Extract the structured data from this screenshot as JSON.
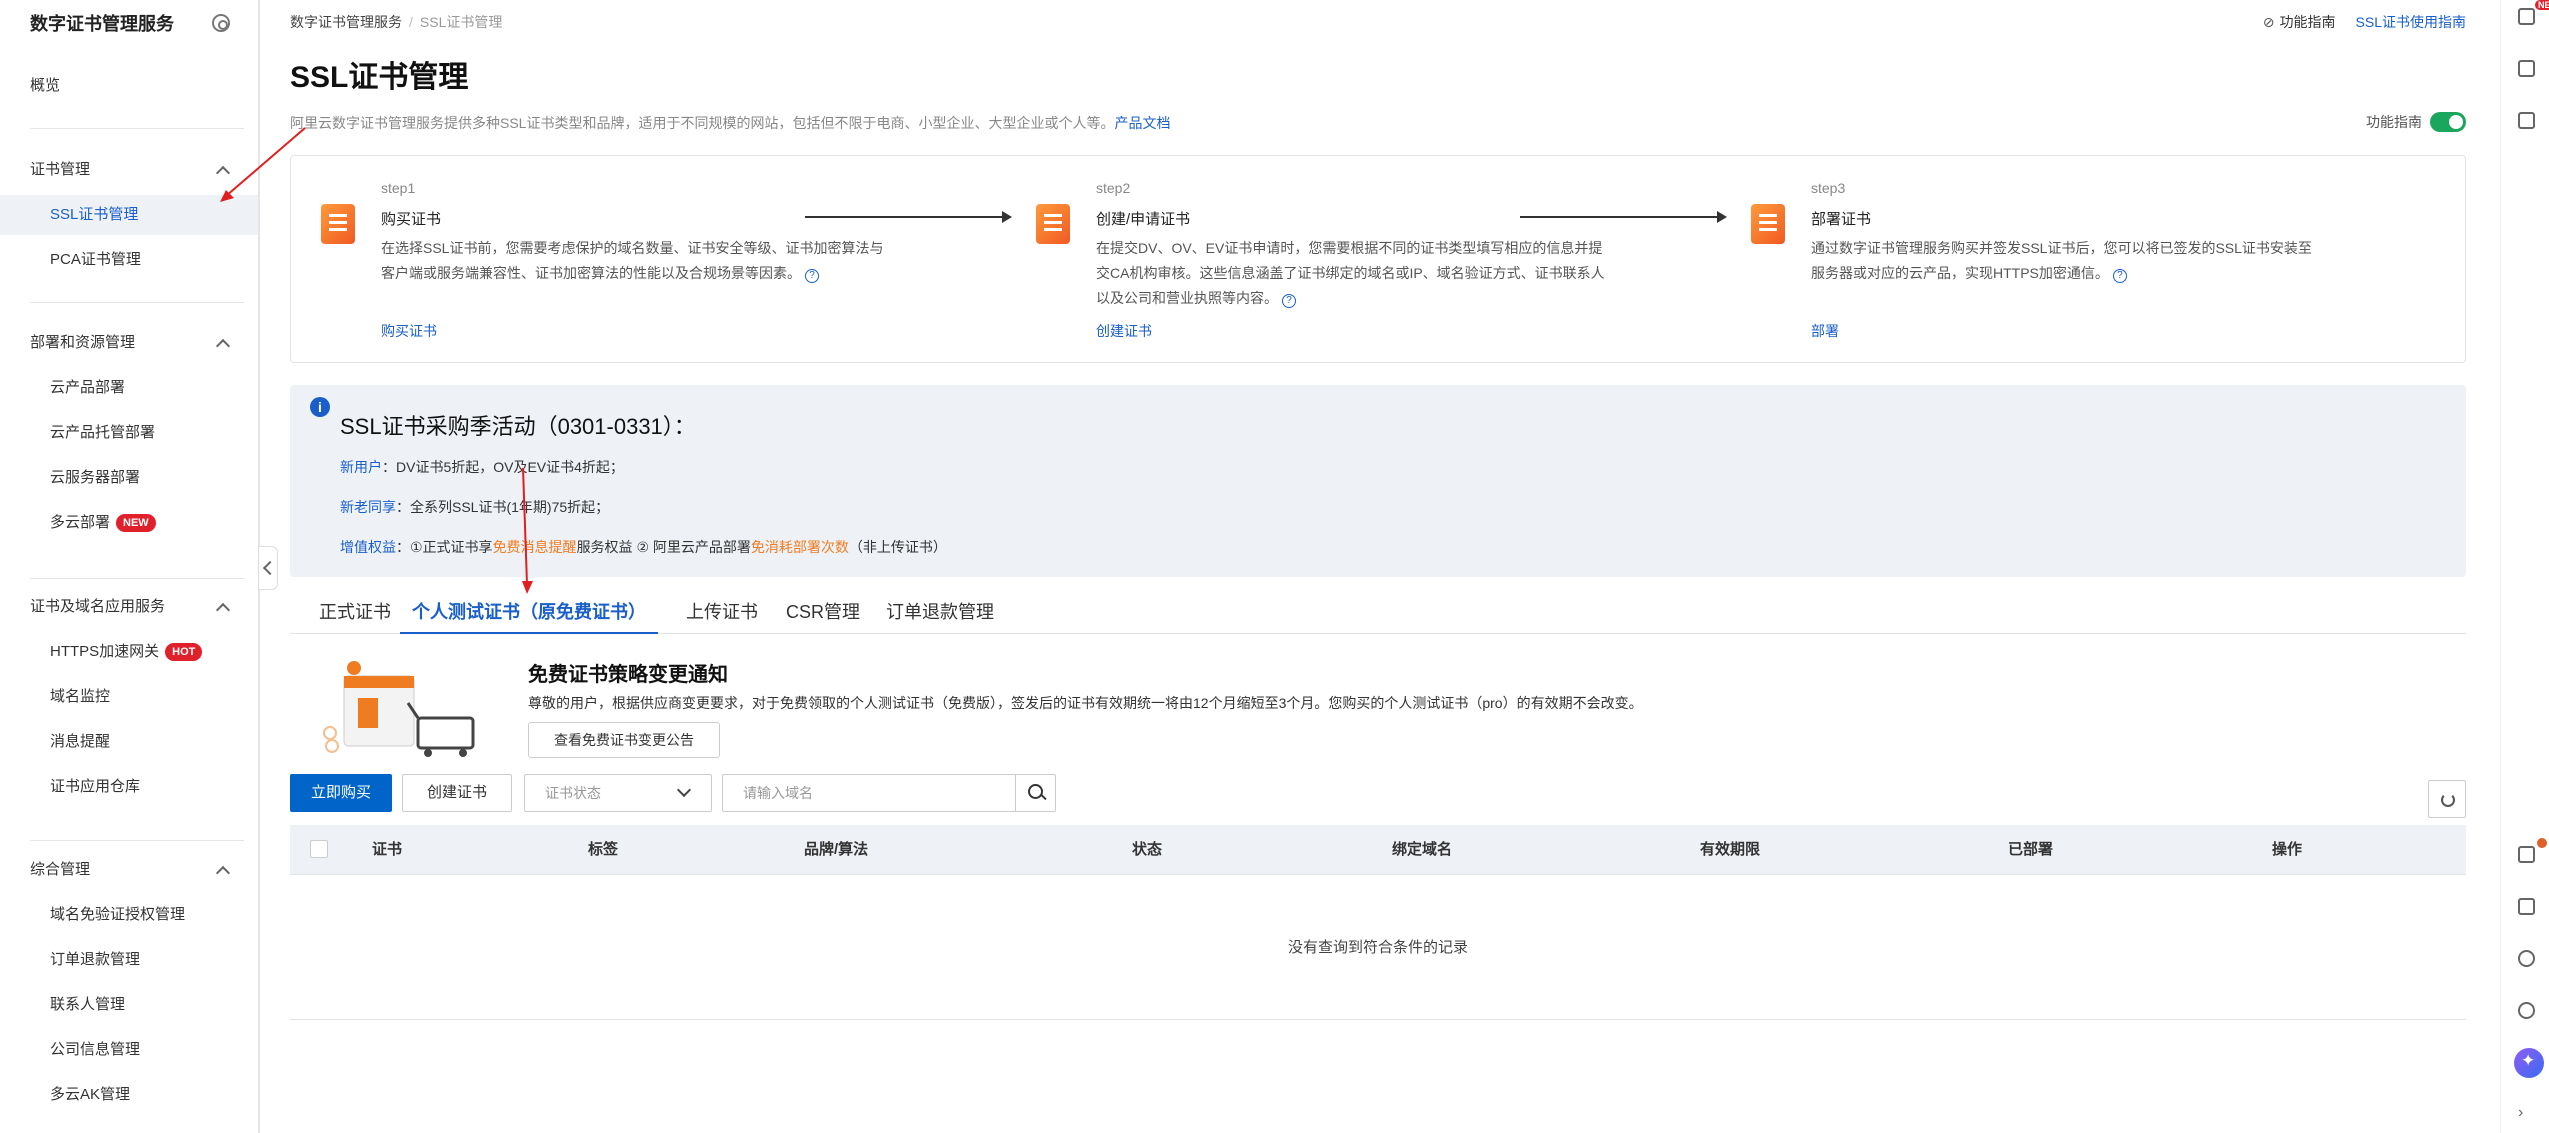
{
  "sidebar": {
    "title": "数字证书管理服务",
    "overview": "概览",
    "groups": [
      {
        "label": "证书管理",
        "items": [
          "SSL证书管理",
          "PCA证书管理"
        ]
      },
      {
        "label": "部署和资源管理",
        "items": [
          "云产品部署",
          "云产品托管部署",
          "云服务器部署",
          "多云部署"
        ]
      },
      {
        "label": "证书及域名应用服务",
        "items": [
          "HTTPS加速网关",
          "域名监控",
          "消息提醒",
          "证书应用仓库"
        ]
      },
      {
        "label": "综合管理",
        "items": [
          "域名免验证授权管理",
          "订单退款管理",
          "联系人管理",
          "公司信息管理",
          "多云AK管理"
        ]
      }
    ],
    "tags": {
      "new": "NEW",
      "hot": "HOT"
    }
  },
  "rail": {
    "badge": "NEW"
  },
  "breadcrumb": {
    "root": "数字证书管理服务",
    "current": "SSL证书管理"
  },
  "top_links": {
    "guide": "功能指南",
    "usage": "SSL证书使用指南"
  },
  "page": {
    "title": "SSL证书管理",
    "intro": "阿里云数字证书管理服务提供多种SSL证书类型和品牌，适用于不同规模的网站，包括但不限于电商、小型企业、大型企业或个人等。",
    "intro_link": "产品文档",
    "guide_toggle": "功能指南"
  },
  "steps": [
    {
      "num": "step1",
      "name": "购买证书",
      "desc": "在选择SSL证书前，您需要考虑保护的域名数量、证书安全等级、证书加密算法与客户端或服务端兼容性、证书加密算法的性能以及合规场景等因素。",
      "link": "购买证书"
    },
    {
      "num": "step2",
      "name": "创建/申请证书",
      "desc": "在提交DV、OV、EV证书申请时，您需要根据不同的证书类型填写相应的信息并提交CA机构审核。这些信息涵盖了证书绑定的域名或IP、域名验证方式、证书联系人以及公司和营业执照等内容。",
      "link": "创建证书"
    },
    {
      "num": "step3",
      "name": "部署证书",
      "desc": "通过数字证书管理服务购买并签发SSL证书后，您可以将已签发的SSL证书安装至服务器或对应的云产品，实现HTTPS加密通信。",
      "link": "部署"
    }
  ],
  "promo": {
    "title": "SSL证书采购季活动（0301-0331）：",
    "line1_k": "新用户",
    "line1": "：DV证书5折起，OV及EV证书4折起；",
    "line2_k": "新老同享",
    "line2": "：全系列SSL证书(1年期)75折起；",
    "line3_k": "增值权益",
    "line3_a": "：①正式证书享",
    "line3_hl1": "免费消息提醒",
    "line3_b": "服务权益  ② 阿里云产品部署",
    "line3_hl2": "免消耗部署次数",
    "line3_c": "（非上传证书）"
  },
  "tabs": [
    "正式证书",
    "个人测试证书（原免费证书）",
    "上传证书",
    "CSR管理",
    "订单退款管理"
  ],
  "notice": {
    "title": "免费证书策略变更通知",
    "desc": "尊敬的用户，根据供应商变更要求，对于免费领取的个人测试证书（免费版），签发后的证书有效期统一将由12个月缩短至3个月。您购买的个人测试证书（pro）的有效期不会改变。",
    "button": "查看免费证书变更公告"
  },
  "toolbar": {
    "buy": "立即购买",
    "create": "创建证书",
    "status_placeholder": "证书状态",
    "search_placeholder": "请输入域名"
  },
  "table": {
    "columns": [
      "证书",
      "标签",
      "品牌/算法",
      "状态",
      "绑定域名",
      "有效期限",
      "已部署",
      "操作"
    ],
    "empty": "没有查询到符合条件的记录"
  },
  "colors": {
    "primary": "#0064c8",
    "link": "#1a5fc9",
    "highlight": "#f07c22",
    "annotation": "#e02020"
  }
}
